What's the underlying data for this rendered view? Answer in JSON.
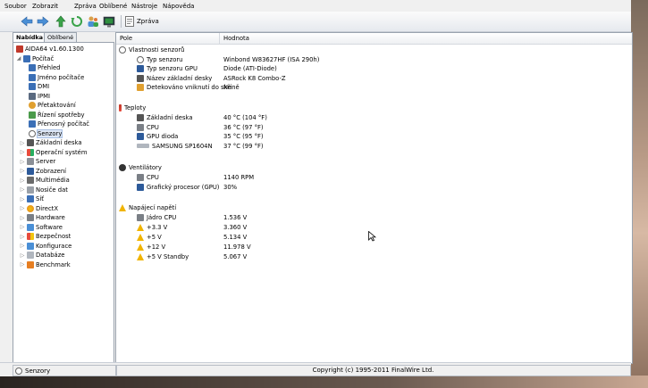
{
  "menu": [
    "Soubor",
    "Zobrazit",
    "Zpráva",
    "Oblíbené",
    "Nástroje",
    "Nápověda"
  ],
  "toolbar": {
    "report_label": "Zpráva"
  },
  "tabs": {
    "menu": "Nabídka",
    "favorites": "Oblíbené"
  },
  "tree": {
    "root": "AIDA64 v1.60.1300",
    "computer": "Počítač",
    "computer_children": [
      "Přehled",
      "Jméno počítače",
      "DMI",
      "IPMI",
      "Přetaktování",
      "Řízení spotřeby",
      "Přenosný počítač",
      "Senzory"
    ],
    "sections": [
      "Základní deska",
      "Operační systém",
      "Server",
      "Zobrazení",
      "Multimédia",
      "Nosiče dat",
      "Síť",
      "DirectX",
      "Hardware",
      "Software",
      "Bezpečnost",
      "Konfigurace",
      "Databáze",
      "Benchmark"
    ]
  },
  "columns": {
    "field": "Pole",
    "value": "Hodnota"
  },
  "groups": {
    "sensor_props": {
      "title": "Vlastnosti senzorů",
      "rows": [
        {
          "field": "Typ senzoru",
          "value": "Winbond W83627HF  (ISA 290h)"
        },
        {
          "field": "Typ senzoru GPU",
          "value": "Diode  (ATI-Diode)"
        },
        {
          "field": "Název základní desky",
          "value": "ASRock K8 Combo-Z"
        },
        {
          "field": "Detekováno vniknutí do skříně",
          "value": "Ne"
        }
      ]
    },
    "temps": {
      "title": "Teploty",
      "rows": [
        {
          "field": "Základní deska",
          "value": "40 °C  (104 °F)"
        },
        {
          "field": "CPU",
          "value": "36 °C  (97 °F)"
        },
        {
          "field": "GPU dioda",
          "value": "35 °C  (95 °F)"
        },
        {
          "field": "SAMSUNG SP1604N",
          "value": "37 °C  (99 °F)"
        }
      ]
    },
    "fans": {
      "title": "Ventilátory",
      "rows": [
        {
          "field": "CPU",
          "value": "1140 RPM"
        },
        {
          "field": "Grafický procesor (GPU)",
          "value": "30%"
        }
      ]
    },
    "voltages": {
      "title": "Napájecí napětí",
      "rows": [
        {
          "field": "Jádro CPU",
          "value": "1.536 V"
        },
        {
          "field": "+3.3 V",
          "value": "3.360 V"
        },
        {
          "field": "+5 V",
          "value": "5.134 V"
        },
        {
          "field": "+12 V",
          "value": "11.978 V"
        },
        {
          "field": "+5 V Standby",
          "value": "5.067 V"
        }
      ]
    }
  },
  "status": {
    "left": "Senzory",
    "right": "Copyright (c) 1995-2011 FinalWire Ltd."
  }
}
